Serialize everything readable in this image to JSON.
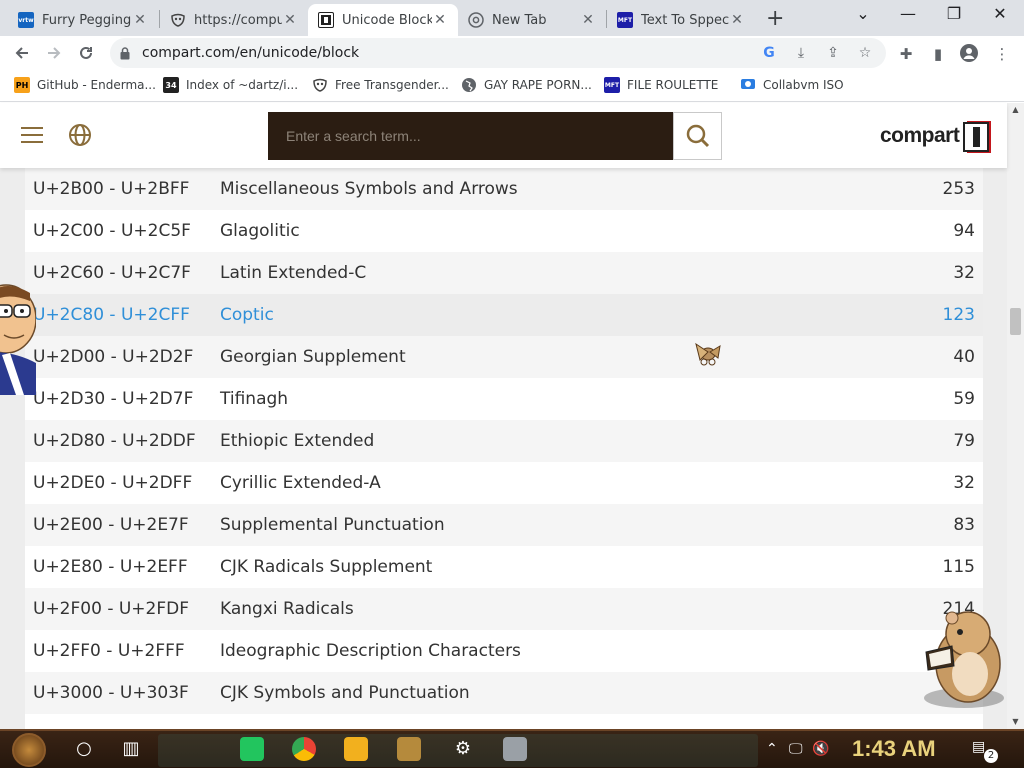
{
  "browser": {
    "tabs": [
      {
        "title": "Furry Pegging",
        "favicon": "vrtw-icon",
        "active": false
      },
      {
        "title": "https://compu",
        "favicon": "mask-icon",
        "active": false
      },
      {
        "title": "Unicode Blocks",
        "favicon": "compart-icon",
        "active": true
      },
      {
        "title": "New Tab",
        "favicon": "chrome-icon",
        "active": false
      },
      {
        "title": "Text To Sppec",
        "favicon": "mft-icon",
        "active": false
      }
    ],
    "new_tab_label": "+",
    "url": "compart.com/en/unicode/block",
    "bookmarks": [
      {
        "label": "GitHub - Enderma...",
        "icon": "ph-icon"
      },
      {
        "label": "Index of ~dartz/i...",
        "icon": "index-icon"
      },
      {
        "label": "Free Transgender...",
        "icon": "mask-icon"
      },
      {
        "label": "GAY RAPE PORN...",
        "icon": "globe-icon"
      },
      {
        "label": "FILE ROULETTE",
        "icon": "mft-icon"
      },
      {
        "label": "Collabvm ISO",
        "icon": "collabvm-icon"
      }
    ],
    "favicon_labels": {
      "vrtw": "vrtw",
      "ph": "PH",
      "mft": "MFT",
      "index": "34"
    }
  },
  "site": {
    "search_placeholder": "Enter a search term...",
    "logo_text": "compart"
  },
  "blocks": [
    {
      "range": "U+2B00 - U+2BFF",
      "name": "Miscellaneous Symbols and Arrows",
      "count": "253"
    },
    {
      "range": "U+2C00 - U+2C5F",
      "name": "Glagolitic",
      "count": "94"
    },
    {
      "range": "U+2C60 - U+2C7F",
      "name": "Latin Extended-C",
      "count": "32"
    },
    {
      "range": "U+2C80 - U+2CFF",
      "name": "Coptic",
      "count": "123",
      "highlighted": true
    },
    {
      "range": "U+2D00 - U+2D2F",
      "name": "Georgian Supplement",
      "count": "40"
    },
    {
      "range": "U+2D30 - U+2D7F",
      "name": "Tifinagh",
      "count": "59"
    },
    {
      "range": "U+2D80 - U+2DDF",
      "name": "Ethiopic Extended",
      "count": "79"
    },
    {
      "range": "U+2DE0 - U+2DFF",
      "name": "Cyrillic Extended-A",
      "count": "32"
    },
    {
      "range": "U+2E00 - U+2E7F",
      "name": "Supplemental Punctuation",
      "count": "83"
    },
    {
      "range": "U+2E80 - U+2EFF",
      "name": "CJK Radicals Supplement",
      "count": "115"
    },
    {
      "range": "U+2F00 - U+2FDF",
      "name": "Kangxi Radicals",
      "count": "214"
    },
    {
      "range": "U+2FF0 - U+2FFF",
      "name": "Ideographic Description Characters",
      "count": ""
    },
    {
      "range": "U+3000 - U+303F",
      "name": "CJK Symbols and Punctuation",
      "count": ""
    }
  ],
  "taskbar": {
    "clock": "1:43 AM",
    "notification_count": "2"
  },
  "colors": {
    "highlight": "#2f8fd8",
    "search_bg": "#2b1d12",
    "taskbar": "#2d1b0f"
  }
}
